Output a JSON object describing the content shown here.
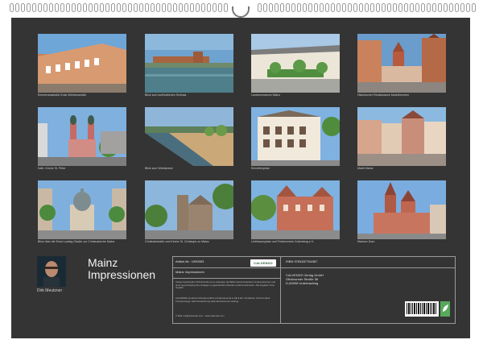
{
  "captions": [
    "Emmeransstraße Ecke Weintorstraße",
    "Blick zum kurfürstlichen Schloss",
    "Landesmuseum Mainz",
    "Historischer Renaissance Marktbrunnen",
    "Kath. Kirche St. Peter",
    "Blick zum Weinstrand",
    "Kirmeltenplatz",
    "Markt Mainz",
    "Blick über die Ernst Ludwig Straße zur Christuskirche Mainz",
    "Christofsstraße und Kirche St. Christoph zu Mainz",
    "Liebfrauenplatz und Förderverein Gutenberg e.V.",
    "Mainzer Dom"
  ],
  "title": {
    "line1": "Mainz",
    "line2": "Impressionen"
  },
  "author": "Dirk Meutzner",
  "info": {
    "article_label": "Artikel-Nr.: 1990353",
    "brand": "CALVENDO",
    "subtitle": "Mainz Impressionen",
    "body": "Infolge bestehender Schutzrechte ist es untersagt, die Bilder dieses Kalenders herauszutrennen und ohne Genehmigung des Verlages zu gewerblichen Zwecken weiterzuverbreiten. Alle Angaben ohne Gewähr.",
    "body2": "CALVENDO produziert klimafreundlich und klimaneutral in DE & EU. Produktion CO2-frei dank Transportwege. Mehr Reduzierung dank Emissionsvermeidung.",
    "mail": "© Mail: info@calvendo.com · www.calvendo.com",
    "isbn": "ISBN 9783457764367",
    "publisher": [
      "CALVENDO Verlag GmbH",
      "Ottobrunner Straße 38",
      "D-82008 Unterhaching"
    ]
  },
  "colors": {
    "background": "#343434",
    "paper": "#ffffff",
    "accent": "#58a85c"
  }
}
